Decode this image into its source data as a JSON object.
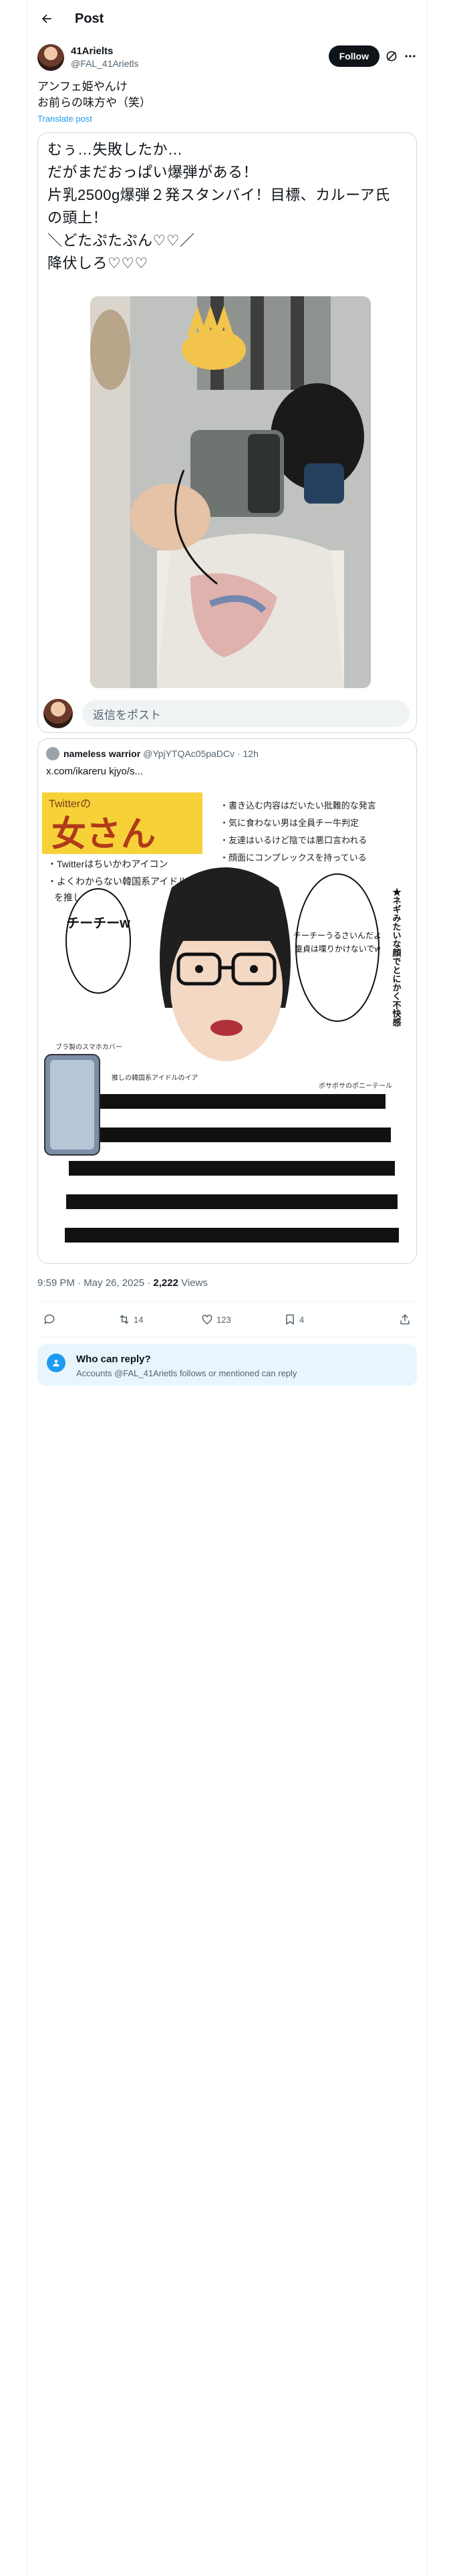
{
  "header": {
    "title": "Post"
  },
  "author": {
    "name": "41Arielts",
    "handle": "@FAL_41Arietls",
    "follow_label": "Follow"
  },
  "post": {
    "lines": [
      "アンフェ姫やんけ",
      "お前らの味方や（笑）"
    ],
    "translate_label": "Translate post"
  },
  "embedded_text": {
    "lines": [
      "むぅ…失敗したか…",
      "だがまだおっぱい爆弾がある！",
      "片乳2500g爆弾２発スタンバイ！目標、カルーア氏",
      "の頭上！",
      "＼どたぷたぷん♡♡／",
      "降伏しろ♡♡♡"
    ]
  },
  "reply": {
    "placeholder": "返信をポスト"
  },
  "quote": {
    "name": "nameless warrior",
    "handle_time": "@YpjYTQAc05paDCv · 12h",
    "link": "x.com/ikareru kjyo/s..."
  },
  "meme": {
    "banner_small": "Twitterの",
    "banner_big": "女さん",
    "left_notes": [
      "・Twitterはちいかわアイコン",
      "・よくわからない韓国系アイドル",
      "を推している"
    ],
    "right_notes": [
      "・書き込む内容はだいたい批難的な発言",
      "・気に食わない男は全員チー牛判定",
      "・友達はいるけど陰では悪口言われる",
      "・顔面にコンプレックスを持っている"
    ],
    "bubble_left": "チーチーw",
    "bubble_right": [
      "チーチーうるさいんだよ",
      "童貞は喋りかけないでw"
    ],
    "side_title": "★ネギみたいな顔でとにかく不快感",
    "phone_note": "ブラ製のスマホカバー",
    "idol_note": "推しの韓国系アイドルのイア",
    "ponytail_note": "ボサボサのポニーテール"
  },
  "meta": {
    "time": "9:59 PM · May 26, 2025 · ",
    "views": "2,222",
    "views_label": " Views"
  },
  "actions": {
    "retweets": "14",
    "likes": "123",
    "bookmarks": "4"
  },
  "who_can_reply": {
    "title": "Who can reply?",
    "subtitle": "Accounts @FAL_41Arietls follows or mentioned can reply"
  },
  "colors": {
    "accent": "#1d9bf0",
    "banner_yellow": "#f7d138",
    "text": "#0f1419",
    "muted": "#536471"
  }
}
